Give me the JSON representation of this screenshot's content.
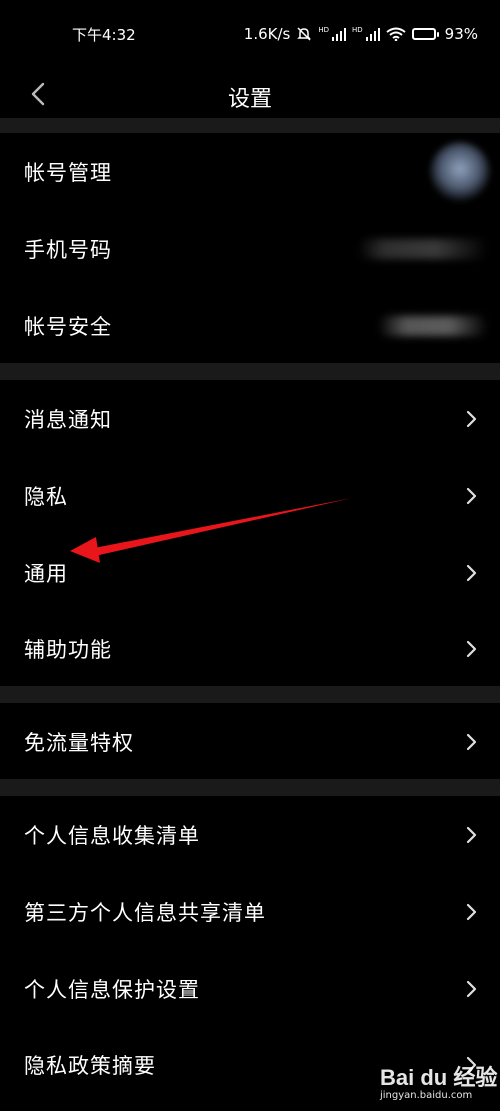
{
  "status_bar": {
    "time": "下午4:32",
    "net_speed": "1.6K/s",
    "hd1": "HD",
    "hd2": "HD",
    "battery": "93%",
    "battery_level": 0.93
  },
  "header": {
    "title": "设置"
  },
  "account_section": [
    {
      "label": "帐号管理"
    },
    {
      "label": "手机号码"
    },
    {
      "label": "帐号安全"
    }
  ],
  "main_section": [
    {
      "label": "消息通知"
    },
    {
      "label": "隐私"
    },
    {
      "label": "通用"
    },
    {
      "label": "辅助功能"
    }
  ],
  "traffic_section": [
    {
      "label": "免流量特权"
    }
  ],
  "info_section": [
    {
      "label": "个人信息收集清单"
    },
    {
      "label": "第三方个人信息共享清单"
    },
    {
      "label": "个人信息保护设置"
    },
    {
      "label": "隐私政策摘要"
    }
  ],
  "watermark": {
    "text": "Bai du 经验",
    "url": "jingyan.baidu.com"
  },
  "colors": {
    "background": "#000000",
    "section_gap": "#1a1a1a",
    "text": "#ffffff",
    "chevron": "#e0e0e0",
    "annotation": "#e8151b"
  }
}
